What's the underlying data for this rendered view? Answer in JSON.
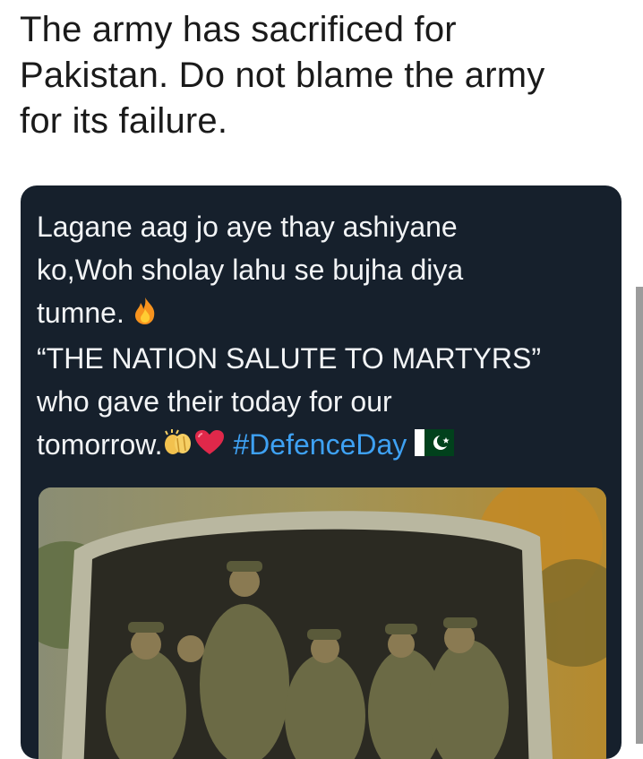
{
  "post": {
    "text_lines": [
      "The army has sacrificed for",
      "Pakistan. Do not blame the army",
      "for its failure."
    ]
  },
  "embedded_tweet": {
    "line1": "Lagane aag jo aye thay ashiyane",
    "line2": "ko,Woh sholay lahu se bujha diya",
    "line3": "tumne.",
    "line4": "“THE NATION SALUTE TO MARTYRS”",
    "line5": "who gave their today for our",
    "line6": "tomorrow.",
    "hashtag": "#DefenceDay",
    "emojis": [
      "fire-emoji",
      "clapping-hands-emoji",
      "heart-emoji",
      "pakistan-flag-emoji"
    ]
  },
  "colors": {
    "card_bg": "#16202c",
    "hashtag": "#3ea1f3",
    "flag_green": "#01411c"
  }
}
